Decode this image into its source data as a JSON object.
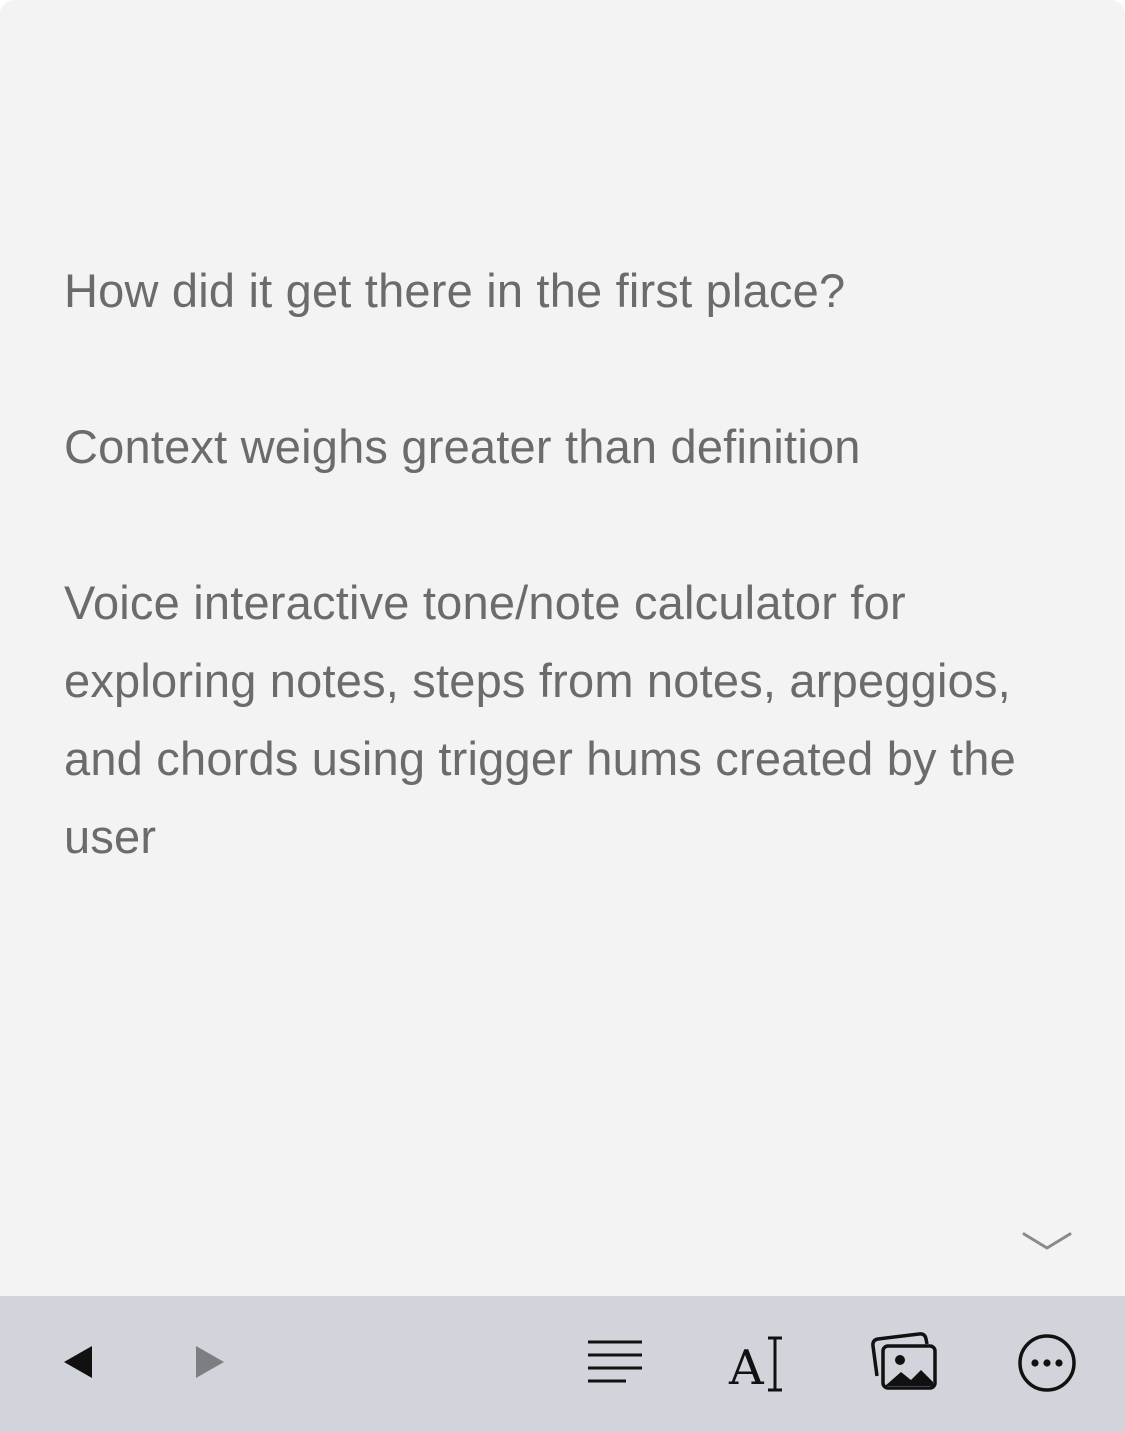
{
  "note": {
    "paragraphs": [
      "How did it get there in the first place?",
      "Context weighs greater than definition",
      "Voice interactive tone/note calculator for exploring notes, steps from notes, arpeggios, and chords using trigger hums created by the user"
    ]
  },
  "toolbar": {
    "back_icon": "back-triangle-icon",
    "forward_icon": "forward-triangle-icon",
    "format_icon": "paragraph-lines-icon",
    "text_style_glyph": "A",
    "text_style_cursor_glyph": "I",
    "photo_icon": "photos-icon",
    "more_icon": "ellipsis-circle-icon"
  },
  "colors": {
    "background": "#f3f3f3",
    "text": "#6b6b6b",
    "toolbar": "#d1d4db",
    "icon": "#111111",
    "icon_disabled": "#7d7e82"
  }
}
